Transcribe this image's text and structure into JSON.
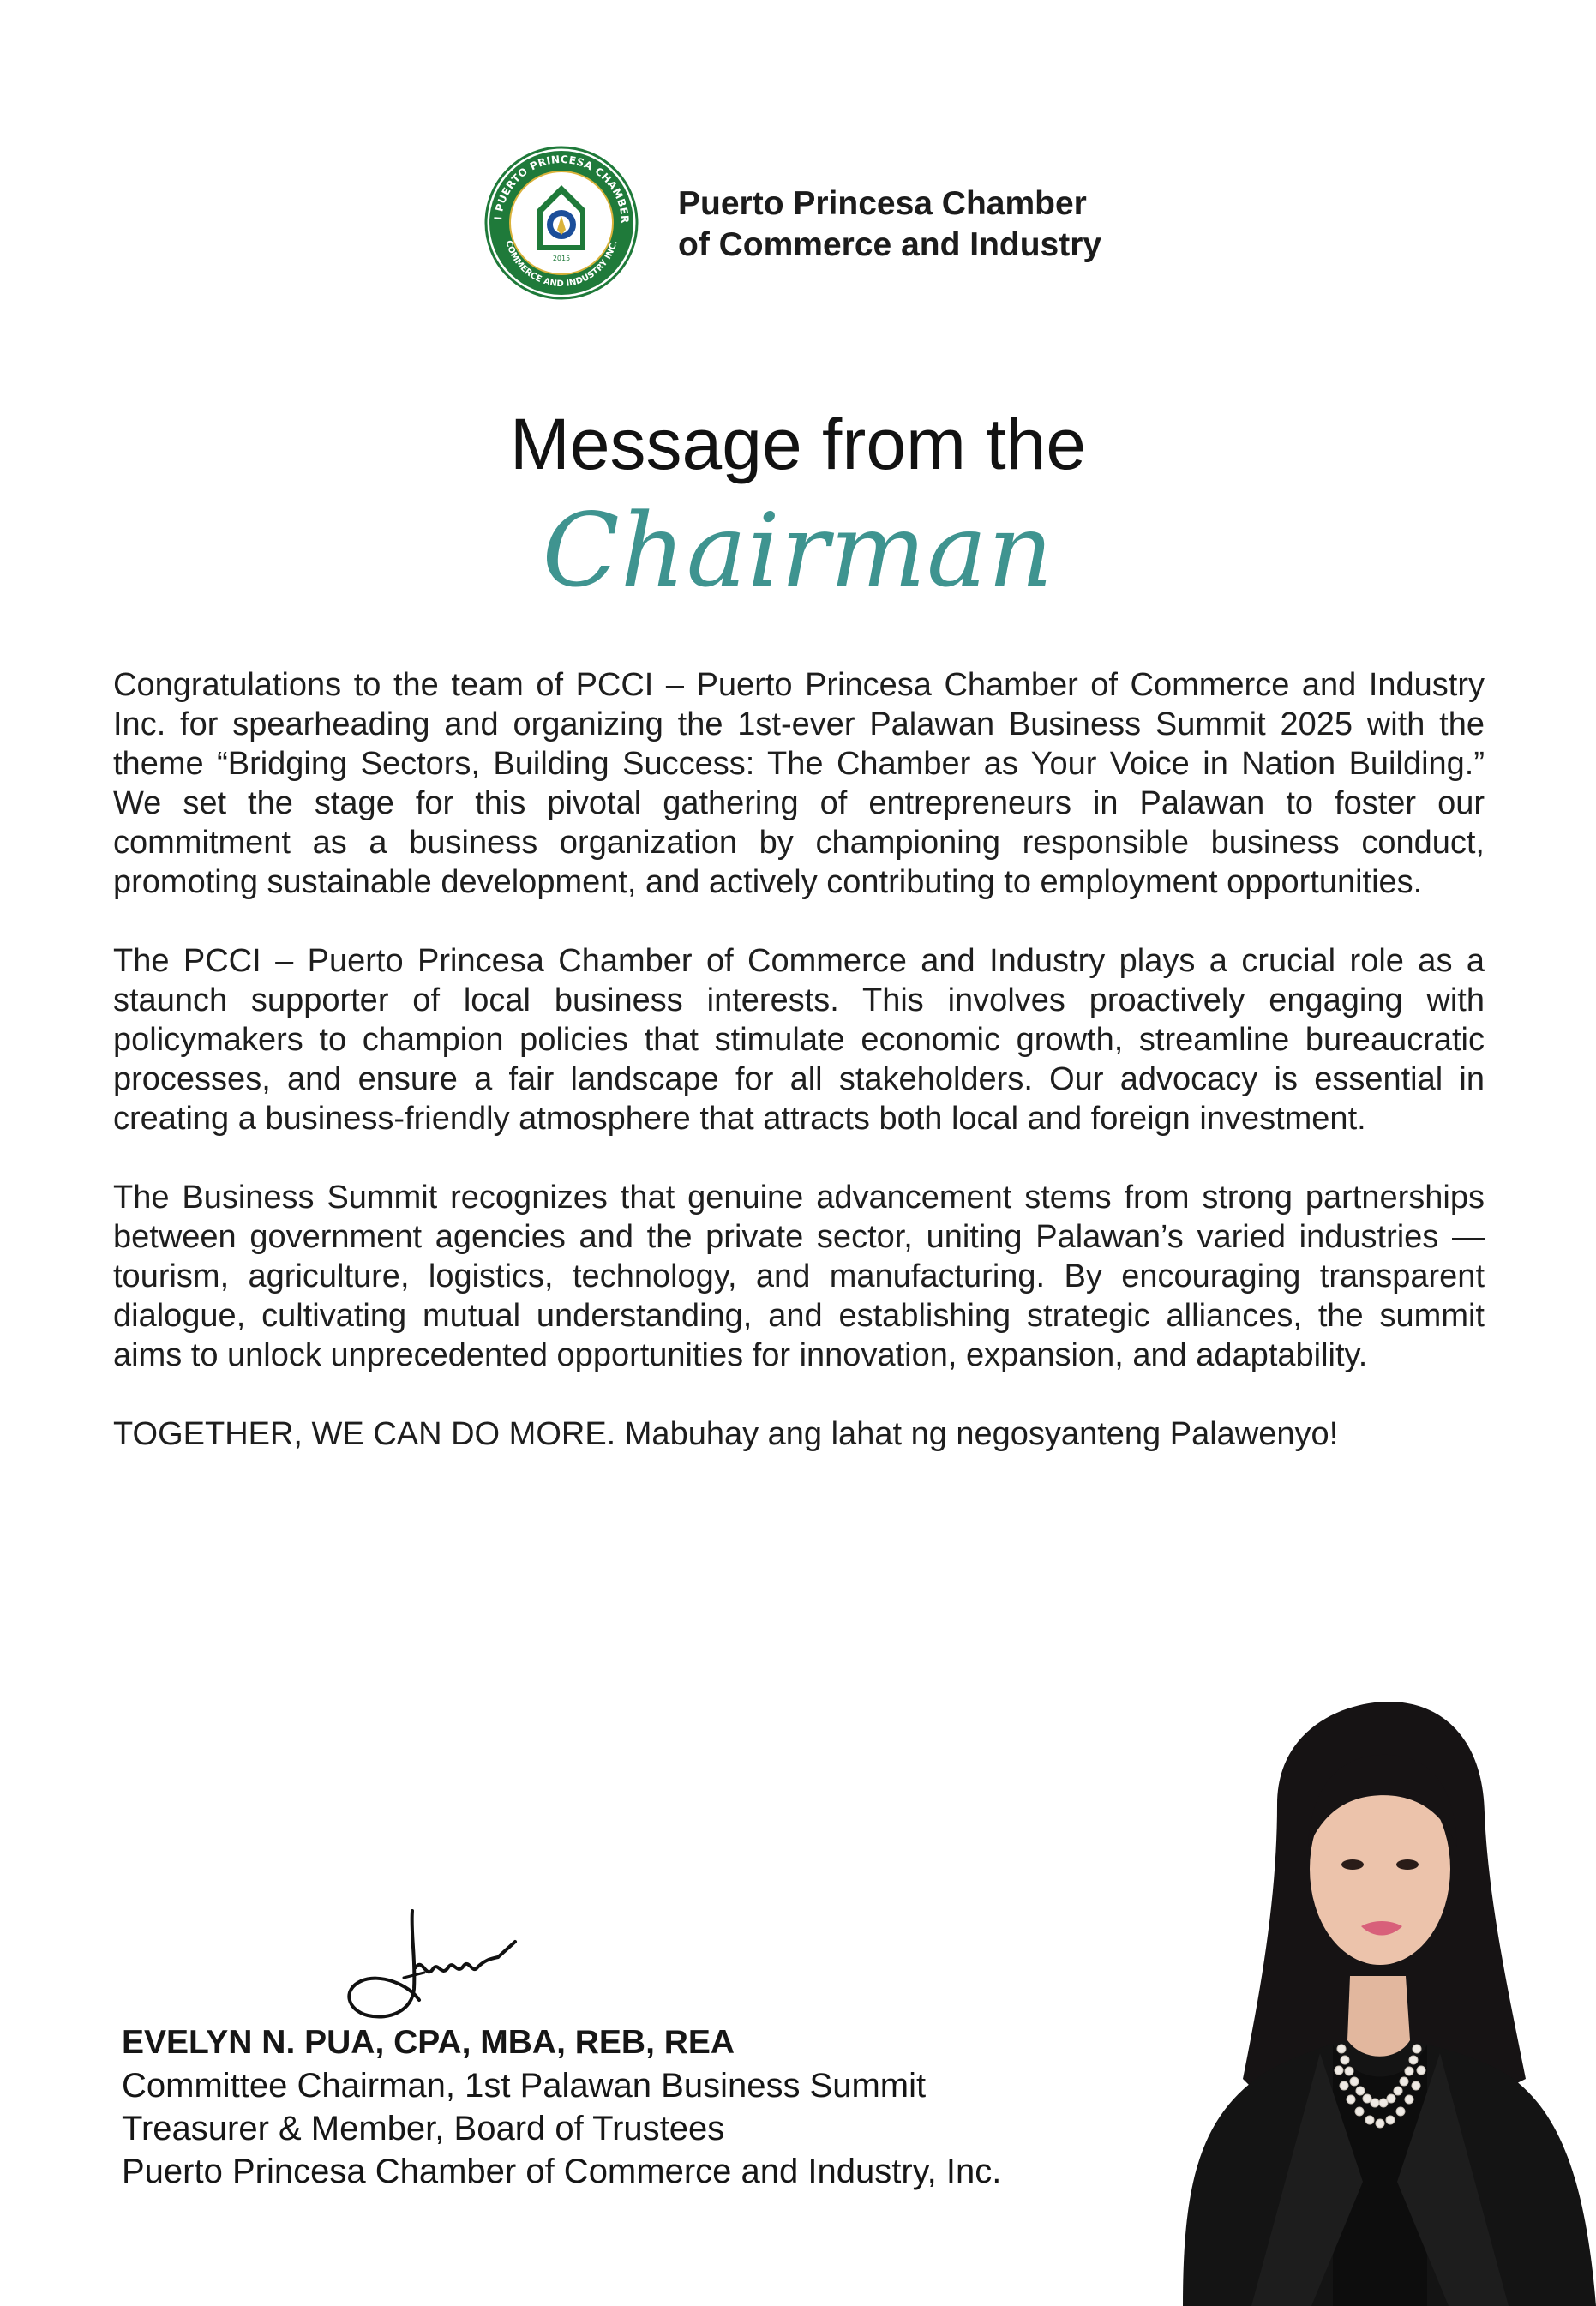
{
  "header": {
    "org_line1": "Puerto Princesa Chamber",
    "org_line2": "of Commerce and Industry",
    "logo": {
      "icon": "pcci-seal-logo",
      "ring_text": "PCCI PUERTO PRINCESA CHAMBER OF COMMERCE AND INDUSTRY INC.",
      "year": "2015",
      "colors": {
        "green": "#1f7a3a",
        "blue": "#1b4e9a",
        "gold": "#d9b23a"
      }
    }
  },
  "title": {
    "line1": "Message from the",
    "line2": "Chairman",
    "accent_color": "#3f9490"
  },
  "body": {
    "paragraphs": [
      "Congratulations to the team of PCCI – Puerto Princesa Chamber of Commerce and Industry Inc. for spearheading and organizing the 1st-ever Palawan Business Summit 2025 with the theme “Bridging Sectors, Building Success: The Chamber as Your Voice in Nation Building.” We set the stage for this pivotal gathering of entrepreneurs in Palawan to foster our commitment as a business organization by championing responsible business conduct, promoting sustainable development, and actively contributing to employment opportunities.",
      "The PCCI – Puerto Princesa Chamber of Commerce and Industry plays a crucial role as a staunch supporter of local business interests. This involves proactively engaging with policymakers to champion policies that stimulate economic growth, streamline bureaucratic processes, and ensure a fair landscape for all stakeholders. Our advocacy is essential in creating a business-friendly atmosphere that attracts both local and foreign investment.",
      "The Business Summit recognizes that genuine advancement stems from strong partnerships between government agencies and the private sector, uniting Palawan’s varied industries — tourism, agriculture, logistics, technology, and manufacturing. By encouraging transparent dialogue, cultivating mutual understanding, and establishing strategic alliances, the summit aims to unlock unprecedented opportunities for innovation, expansion, and adaptability.",
      "TOGETHER, WE CAN DO MORE. Mabuhay ang lahat ng negosyanteng Palawenyo!"
    ]
  },
  "signatory": {
    "name": "EVELYN N. PUA, CPA, MBA, REB, REA",
    "role1": "Committee Chairman, 1st Palawan Business Summit",
    "role2": "Treasurer & Member, Board of Trustees",
    "role3": "Puerto Princesa Chamber of Commerce and Industry, Inc.",
    "signature_icon": "handwritten-signature",
    "photo_icon": "portrait-photo"
  }
}
